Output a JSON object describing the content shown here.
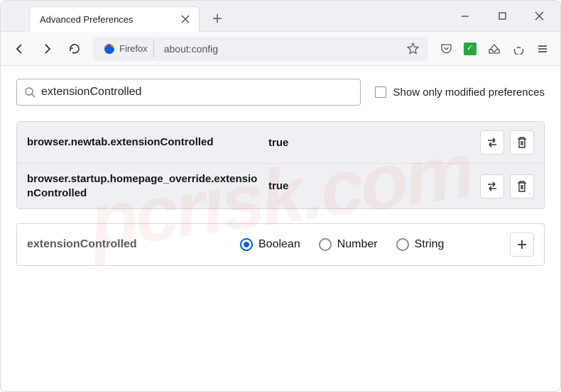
{
  "tab": {
    "title": "Advanced Preferences"
  },
  "urlbar": {
    "identity_label": "Firefox",
    "url": "about:config"
  },
  "search": {
    "value": "extensionControlled",
    "modified_only_label": "Show only modified preferences"
  },
  "prefs": [
    {
      "name": "browser.newtab.extensionControlled",
      "value": "true"
    },
    {
      "name": "browser.startup.homepage_override.extensionControlled",
      "value": "true"
    }
  ],
  "new_pref": {
    "name": "extensionControlled",
    "types": {
      "boolean": "Boolean",
      "number": "Number",
      "string": "String"
    }
  },
  "watermark": "pcrisk.com"
}
